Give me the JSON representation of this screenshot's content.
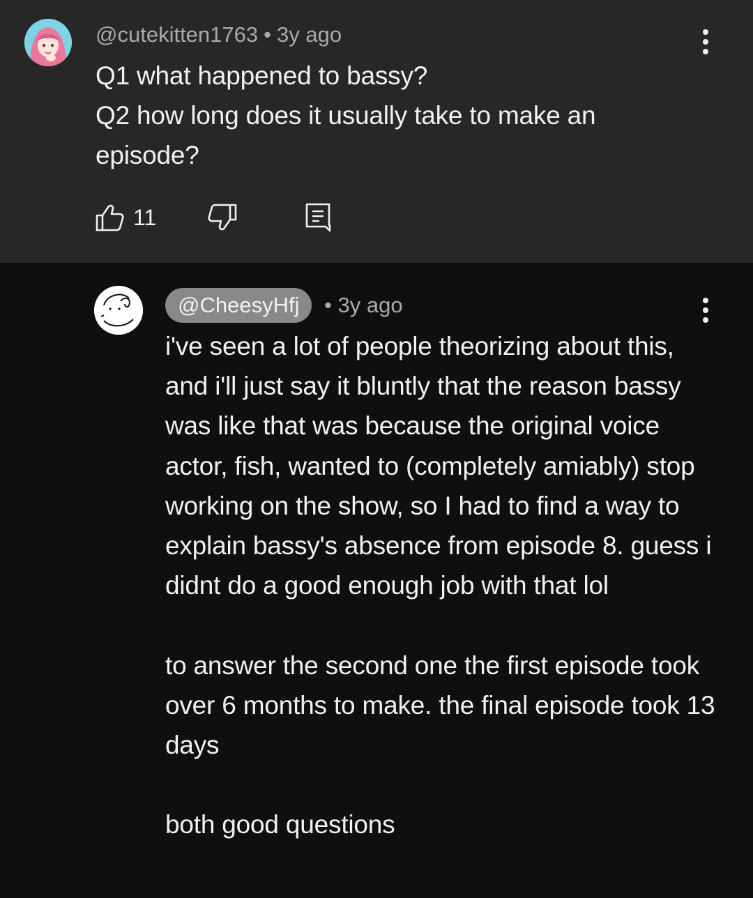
{
  "comment": {
    "author": "@cutekitten1763",
    "separator": "•",
    "time": "3y ago",
    "text": "Q1 what happened to bassy?\nQ2 how long does it usually take to make an episode?",
    "like_count": "11"
  },
  "reply": {
    "author": "@CheesyHfj",
    "separator": "•",
    "time": "3y ago",
    "text": "i've seen a lot of people theorizing about this, and i'll just say it bluntly that the reason bassy was like that was because the original voice actor, fish, wanted to (completely amiably) stop working on the show, so I had to find a way to explain bassy's absence from episode 8. guess i didnt do a good enough job with that lol\n\nto answer the second one the first episode took over 6 months to make. the final episode took 13 days\n\nboth good questions"
  },
  "icons": {
    "like": "thumbs-up-icon",
    "dislike": "thumbs-down-icon",
    "reply": "comment-reply-icon",
    "menu": "more-vert-icon"
  },
  "colors": {
    "top_background": "#272727",
    "page_background": "#0f0f0f",
    "text_primary": "#f1f1f1",
    "text_secondary": "#aaaaaa",
    "author_chip": "#898989"
  }
}
